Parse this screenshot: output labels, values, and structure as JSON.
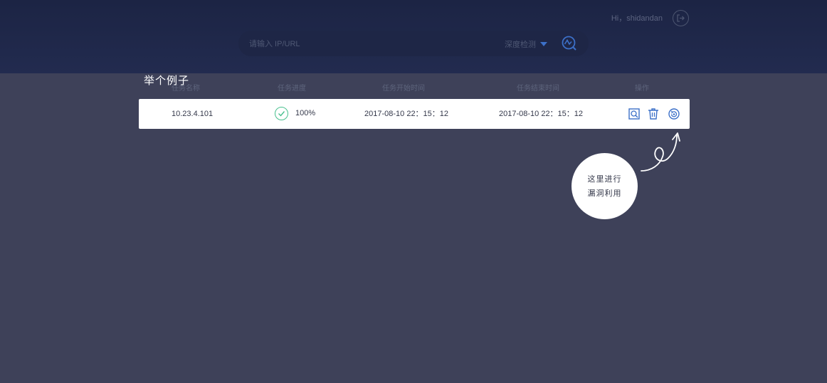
{
  "header": {
    "greeting": "Hi，shidandan",
    "logout_icon": "logout-icon"
  },
  "search": {
    "placeholder": "请输入 IP/URL",
    "mode": "深度检测",
    "scan_icon": "scan-icon"
  },
  "overlay": {
    "title": "举个例子",
    "tip_line1": "这里进行",
    "tip_line2": "漏洞利用"
  },
  "table": {
    "columns": [
      "任务名称",
      "任务进度",
      "任务开始时间",
      "任务结束时间",
      "操作"
    ],
    "rows": [
      {
        "name": "10.23.4.101",
        "progress": "100%",
        "start": "2017-08-10 22：15：12",
        "end": "2017-08-10 22：15：12",
        "actions": [
          "view-icon",
          "delete-icon",
          "exploit-icon"
        ]
      }
    ]
  },
  "colors": {
    "accent": "#3c70c8",
    "success": "#48c08e",
    "background": "#3e4159",
    "header": "#1c2444"
  }
}
